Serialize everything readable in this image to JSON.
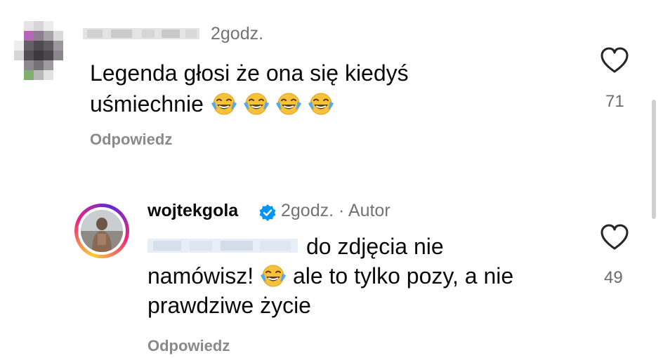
{
  "comment1": {
    "time": "2godz.",
    "text_line1": "Legenda głosi że ona się kiedyś",
    "text_line2": "uśmiechnie",
    "emojis": [
      "face-with-tears-of-joy",
      "face-with-tears-of-joy",
      "face-with-tears-of-joy",
      "face-with-tears-of-joy"
    ],
    "reply_label": "Odpowiedz",
    "likes": "71"
  },
  "comment2": {
    "username": "wojtekgola",
    "meta": "2godz. · Autor",
    "text_line1": "do zdjęcia nie",
    "text_line2a": "namówisz!",
    "text_line2b": "ale to tylko pozy, a nie",
    "text_line3": "prawdziwe życie",
    "emoji": "face-with-tears-of-joy",
    "reply_label": "Odpowiedz",
    "likes": "49"
  },
  "colors": {
    "secondary_text": "#737373",
    "verified_badge": "#0095f6"
  }
}
